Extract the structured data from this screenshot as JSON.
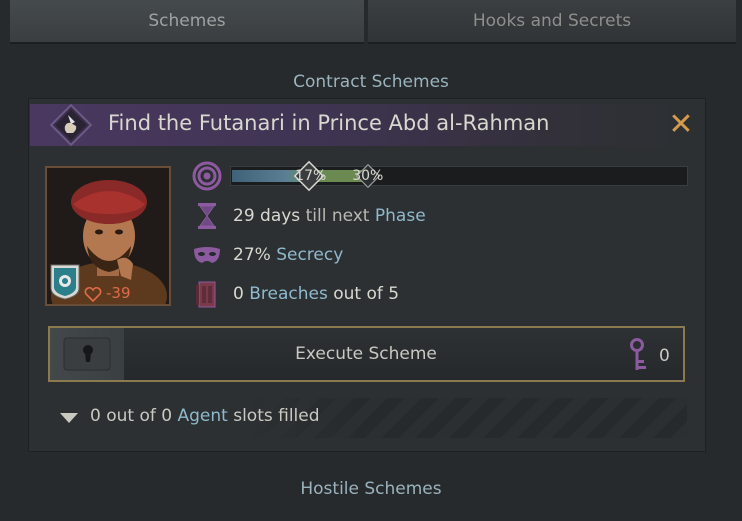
{
  "tabs": [
    {
      "label": "Schemes"
    },
    {
      "label": "Hooks and Secrets"
    }
  ],
  "sections": {
    "contract_title": "Contract Schemes",
    "hostile_title": "Hostile Schemes"
  },
  "scheme": {
    "title": "Find the Futanari in Prince Abd al-Rahman",
    "opinion": "-39",
    "progress": {
      "current_label": "17%",
      "next_label": "30%",
      "current": 0.17,
      "next": 0.3
    },
    "phase": {
      "value": "29 days",
      "mid": " till next ",
      "link": "Phase"
    },
    "secrecy": {
      "value": "27%",
      "link": "Secrecy"
    },
    "breaches": {
      "value": "0",
      "link": "Breaches",
      "suffix": " out of 5"
    },
    "execute_label": "Execute Scheme",
    "key_count": "0",
    "agents": {
      "count": "0 out of 0",
      "link": "Agent",
      "suffix": " slots filled"
    }
  },
  "colors": {
    "accent_link": "#8fb9cc",
    "close": "#d59a4b",
    "opinion": "#e06a4a",
    "purple_icon": "#8c5a9e"
  },
  "icons": {
    "scheme": "dagger-hand-icon",
    "close": "close-icon",
    "progress": "target-icon",
    "phase": "hourglass-icon",
    "secrecy": "mask-icon",
    "breaches": "door-icon",
    "key": "key-icon",
    "agents_toggle": "chevron-down-icon"
  }
}
